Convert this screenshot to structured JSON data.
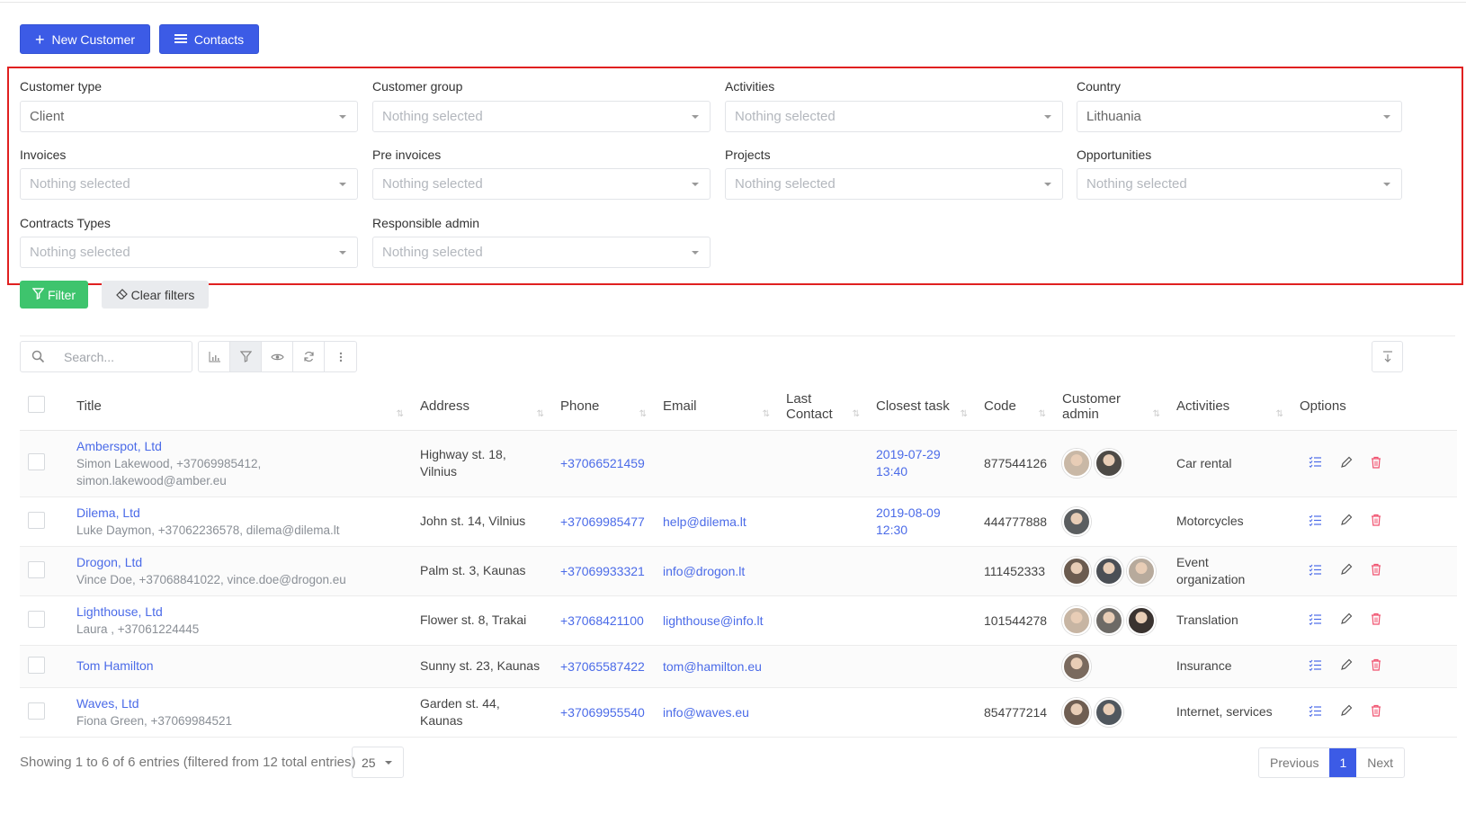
{
  "actions": {
    "new_customer": "New Customer",
    "contacts": "Contacts"
  },
  "filters": {
    "customer_type": {
      "label": "Customer type",
      "value": "Client"
    },
    "customer_group": {
      "label": "Customer group",
      "value": "Nothing selected"
    },
    "activities": {
      "label": "Activities",
      "value": "Nothing selected"
    },
    "country": {
      "label": "Country",
      "value": "Lithuania"
    },
    "invoices": {
      "label": "Invoices",
      "value": "Nothing selected"
    },
    "pre_invoices": {
      "label": "Pre invoices",
      "value": "Nothing selected"
    },
    "projects": {
      "label": "Projects",
      "value": "Nothing selected"
    },
    "opportunities": {
      "label": "Opportunities",
      "value": "Nothing selected"
    },
    "contracts_types": {
      "label": "Contracts Types",
      "value": "Nothing selected"
    },
    "responsible_admin": {
      "label": "Responsible admin",
      "value": "Nothing selected"
    },
    "filter_button": "Filter",
    "clear_button": "Clear filters"
  },
  "search": {
    "placeholder": "Search..."
  },
  "table": {
    "headers": {
      "title": "Title",
      "address": "Address",
      "phone": "Phone",
      "email": "Email",
      "last_contact_1": "Last",
      "last_contact_2": "Contact",
      "closest_task": "Closest task",
      "code": "Code",
      "customer_admin_1": "Customer",
      "customer_admin_2": "admin",
      "activities": "Activities",
      "options": "Options"
    },
    "rows": [
      {
        "title": "Amberspot, Ltd",
        "sub1": "Simon Lakewood, +37069985412,",
        "sub2": "simon.lakewood@amber.eu",
        "address1": "Highway st. 18, Vilnius",
        "address2": "",
        "phone": "+37066521459",
        "email": "",
        "task1": "2019-07-29",
        "task2": "13:40",
        "code": "877544126",
        "activities1": "Car rental",
        "activities2": ""
      },
      {
        "title": "Dilema, Ltd",
        "sub1": "Luke Daymon, +37062236578, dilema@dilema.lt",
        "sub2": "",
        "address1": "John st. 14, Vilnius",
        "address2": "",
        "phone": "+37069985477",
        "email": "help@dilema.lt",
        "task1": "2019-08-09",
        "task2": "12:30",
        "code": "444777888",
        "activities1": "Motorcycles",
        "activities2": ""
      },
      {
        "title": "Drogon, Ltd",
        "sub1": "Vince Doe, +37068841022, vince.doe@drogon.eu",
        "sub2": "",
        "address1": "Palm st. 3, Kaunas",
        "address2": "",
        "phone": "+37069933321",
        "email": "info@drogon.lt",
        "task1": "",
        "task2": "",
        "code": "111452333",
        "activities1": "Event",
        "activities2": "organization"
      },
      {
        "title": "Lighthouse, Ltd",
        "sub1": "Laura , +37061224445",
        "sub2": "",
        "address1": "Flower st. 8, Trakai",
        "address2": "",
        "phone": "+37068421100",
        "email": "lighthouse@info.lt",
        "task1": "",
        "task2": "",
        "code": "101544278",
        "activities1": "Translation",
        "activities2": ""
      },
      {
        "title": "Tom Hamilton",
        "sub1": "",
        "sub2": "",
        "address1": "Sunny st. 23, Kaunas",
        "address2": "",
        "phone": "+37065587422",
        "email": "tom@hamilton.eu",
        "task1": "",
        "task2": "",
        "code": "",
        "activities1": "Insurance",
        "activities2": ""
      },
      {
        "title": "Waves, Ltd",
        "sub1": "Fiona Green, +37069984521",
        "sub2": "",
        "address1": "Garden st. 44,",
        "address2": "Kaunas",
        "phone": "+37069955540",
        "email": "info@waves.eu",
        "task1": "",
        "task2": "",
        "code": "854777214",
        "activities1": "Internet, services",
        "activities2": ""
      }
    ]
  },
  "footer": {
    "info": "Showing 1 to 6 of 6 entries (filtered from 12 total entries)",
    "page_length": "25",
    "previous": "Previous",
    "page": "1",
    "next": "Next"
  },
  "colors": {
    "primary": "#3c5be6",
    "success": "#3ec46d",
    "delete": "#f0506e",
    "highlight_border": "#e02020"
  }
}
